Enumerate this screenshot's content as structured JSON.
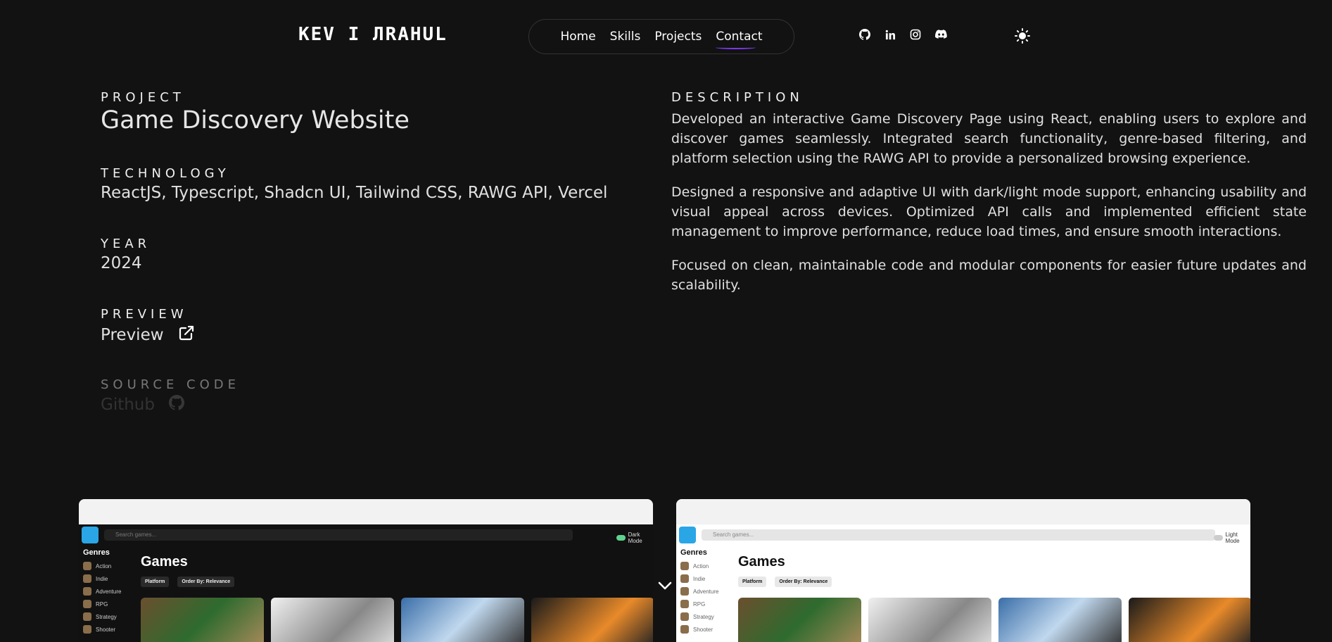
{
  "header": {
    "logo": "KEV I ЛRAHUL",
    "nav": [
      {
        "label": "Home"
      },
      {
        "label": "Skills"
      },
      {
        "label": "Projects"
      },
      {
        "label": "Contact"
      }
    ],
    "socials": [
      "github-icon",
      "linkedin-icon",
      "instagram-icon",
      "discord-icon"
    ],
    "theme_icon": "sun-icon"
  },
  "project": {
    "project_label": "PROJECT",
    "title": "Game Discovery Website",
    "technology_label": "TECHNOLOGY",
    "technology": "ReactJS, Typescript, Shadcn UI, Tailwind CSS, RAWG API, Vercel",
    "year_label": "YEAR",
    "year": "2024",
    "preview_label": "PREVIEW",
    "preview_link": "Preview",
    "source_label": "SOURCE CODE",
    "source_link": "Github"
  },
  "description": {
    "label": "DESCRIPTION",
    "paragraphs": [
      "Developed an interactive Game Discovery Page using React, enabling users to explore and discover games seamlessly. Integrated search functionality, genre-based filtering, and platform selection using the RAWG API to provide a personalized browsing experience.",
      "Designed a responsive and adaptive UI with dark/light mode support, enhancing usability and visual appeal across devices. Optimized API calls and implemented efficient state management to improve performance, reduce load times, and ensure smooth interactions.",
      "Focused on clean, maintainable code and modular components for easier future updates and scalability."
    ]
  },
  "screenshots": {
    "dark": {
      "search_placeholder": "Search games...",
      "mode_label": "Dark Mode",
      "genres_title": "Genres",
      "genres": [
        "Action",
        "Indie",
        "Adventure",
        "RPG",
        "Strategy",
        "Shooter"
      ],
      "games_title": "Games",
      "platform_filter": "Platform",
      "order_filter": "Order By: Relevance"
    },
    "light": {
      "search_placeholder": "Search games...",
      "mode_label": "Light Mode",
      "genres_title": "Genres",
      "genres": [
        "Action",
        "Indie",
        "Adventure",
        "RPG",
        "Strategy",
        "Shooter"
      ],
      "games_title": "Games",
      "platform_filter": "Platform",
      "order_filter": "Order By: Relevance"
    }
  },
  "colors": {
    "background": "#121212",
    "accent_underline": "#7c3aed"
  }
}
